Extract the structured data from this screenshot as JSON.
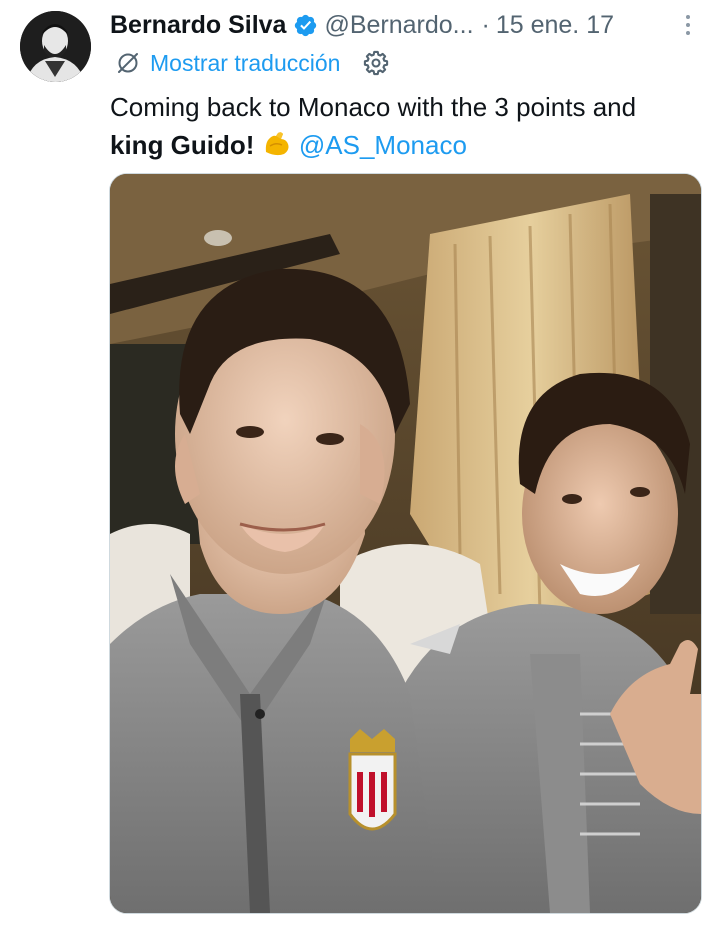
{
  "author": {
    "name": "Bernardo Silva",
    "handle": "@Bernardo...",
    "separator": "·",
    "date": "15 ene. 17"
  },
  "translate": {
    "label": "Mostrar traducción"
  },
  "tweet": {
    "text_part1": "Coming back to Monaco with the 3 points and",
    "text_bold": "king Guido!",
    "mention": "@AS_Monaco"
  },
  "icons": {
    "verified": "verified-badge-icon",
    "translate": "globe-slash-icon",
    "settings": "gear-icon",
    "more": "more-vertical-icon",
    "emoji": "flexed-biceps-emoji"
  },
  "colors": {
    "accent": "#1d9bf0",
    "secondary_text": "#536471",
    "primary_text": "#0f1419"
  }
}
